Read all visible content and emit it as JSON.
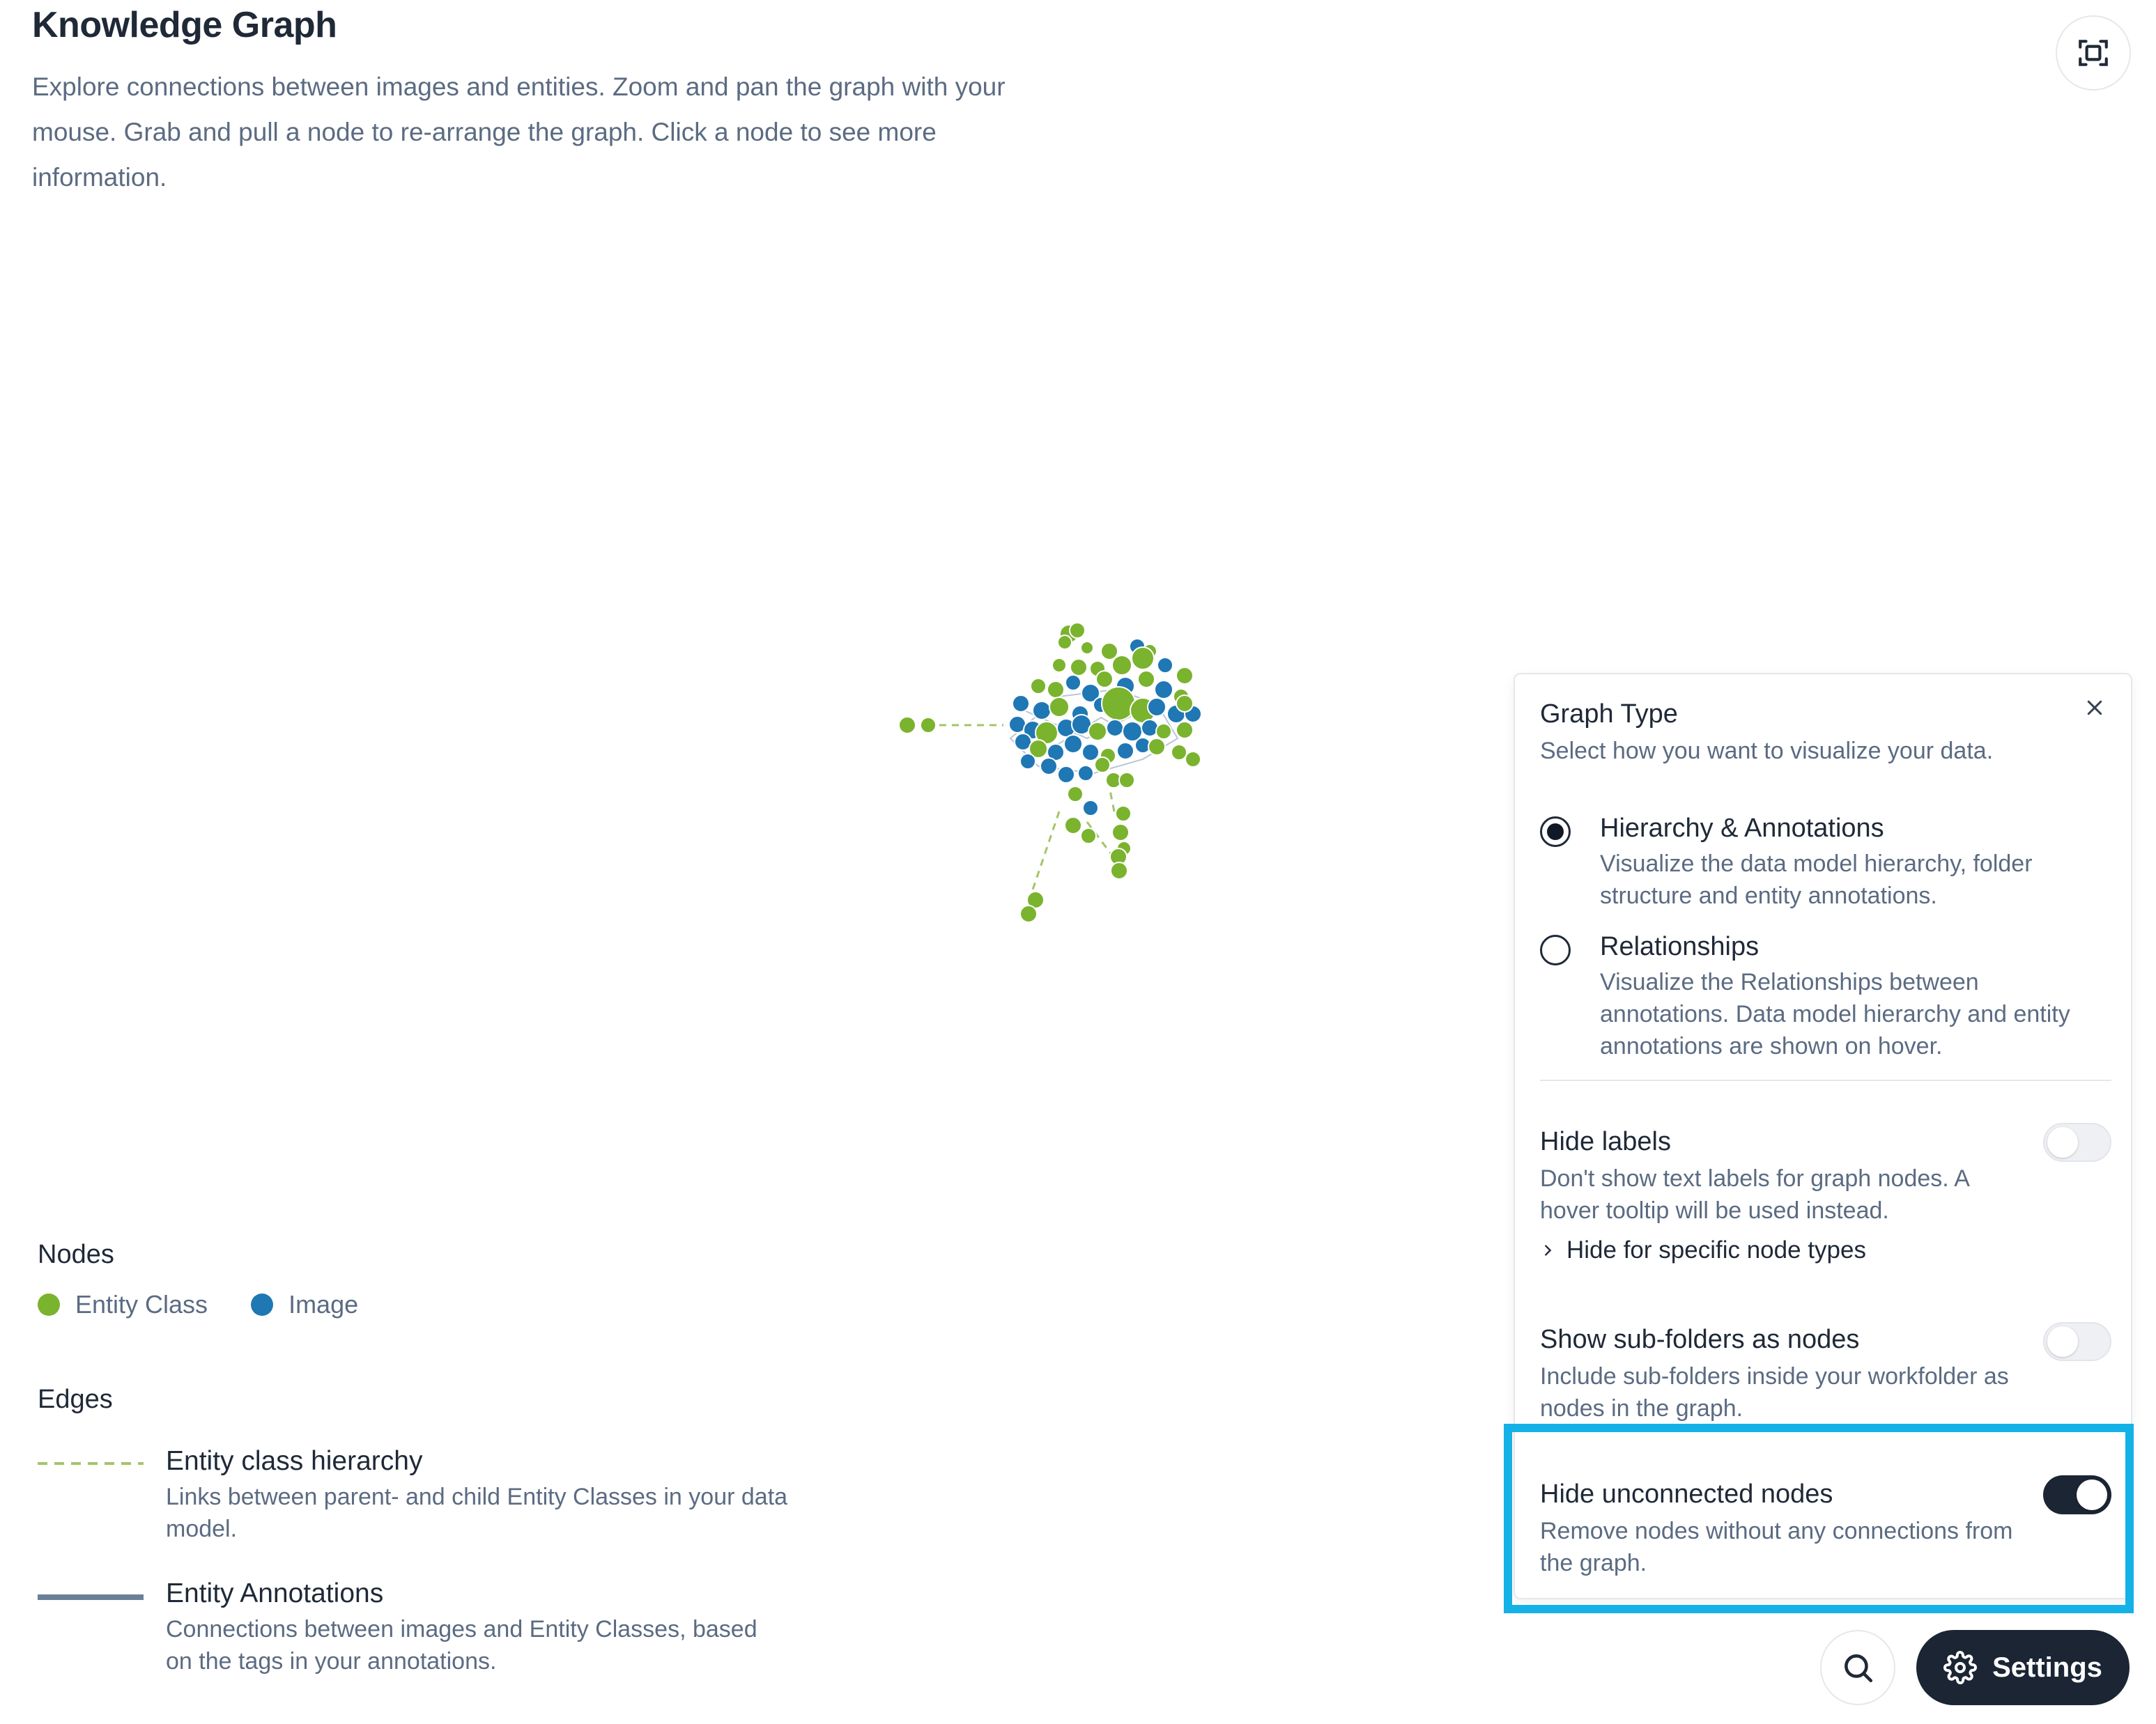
{
  "page": {
    "title": "Knowledge Graph",
    "description": "Explore connections between images and entities. Zoom and pan the graph with your mouse. Grab and pull a node to re-arrange the graph. Click a node to see more information."
  },
  "toolbar": {
    "fit_icon": "fit-view-icon",
    "search_icon": "search-icon",
    "settings_label": "Settings",
    "settings_icon": "gear-icon"
  },
  "legend": {
    "nodes_heading": "Nodes",
    "nodes": [
      {
        "label": "Entity Class",
        "color": "#7ab32e"
      },
      {
        "label": "Image",
        "color": "#1f77b4"
      }
    ],
    "edges_heading": "Edges",
    "edges": [
      {
        "title": "Entity class hierarchy",
        "description": "Links between parent- and child Entity Classes in your data model.",
        "style": "dashed",
        "color": "#a5c46a"
      },
      {
        "title": "Entity Annotations",
        "description": "Connections between images and Entity Classes, based on the tags in your annotations.",
        "style": "solid",
        "color": "#6b7f99"
      }
    ]
  },
  "settings_panel": {
    "graph_type": {
      "title": "Graph Type",
      "subtitle": "Select how you want to visualize your data.",
      "options": [
        {
          "title": "Hierarchy & Annotations",
          "description": "Visualize the data model hierarchy, folder structure and entity annotations.",
          "selected": true
        },
        {
          "title": "Relationships",
          "description": "Visualize the Relationships between annotations. Data model hierarchy and entity annotations are shown on hover.",
          "selected": false
        }
      ]
    },
    "hide_labels": {
      "title": "Hide labels",
      "description": "Don't show text labels for graph nodes. A hover tooltip will be used instead.",
      "link": "Hide for specific node types",
      "enabled": false
    },
    "show_subfolders": {
      "title": "Show sub-folders as nodes",
      "description": "Include sub-folders inside your workfolder as nodes in the graph.",
      "enabled": false
    },
    "hide_unconnected": {
      "title": "Hide unconnected nodes",
      "description": "Remove nodes without any connections from the graph.",
      "enabled": true
    }
  },
  "colors": {
    "entity_class": "#7ab32e",
    "image": "#1f77b4",
    "highlight": "#14b1e7",
    "dark": "#1b2533"
  }
}
